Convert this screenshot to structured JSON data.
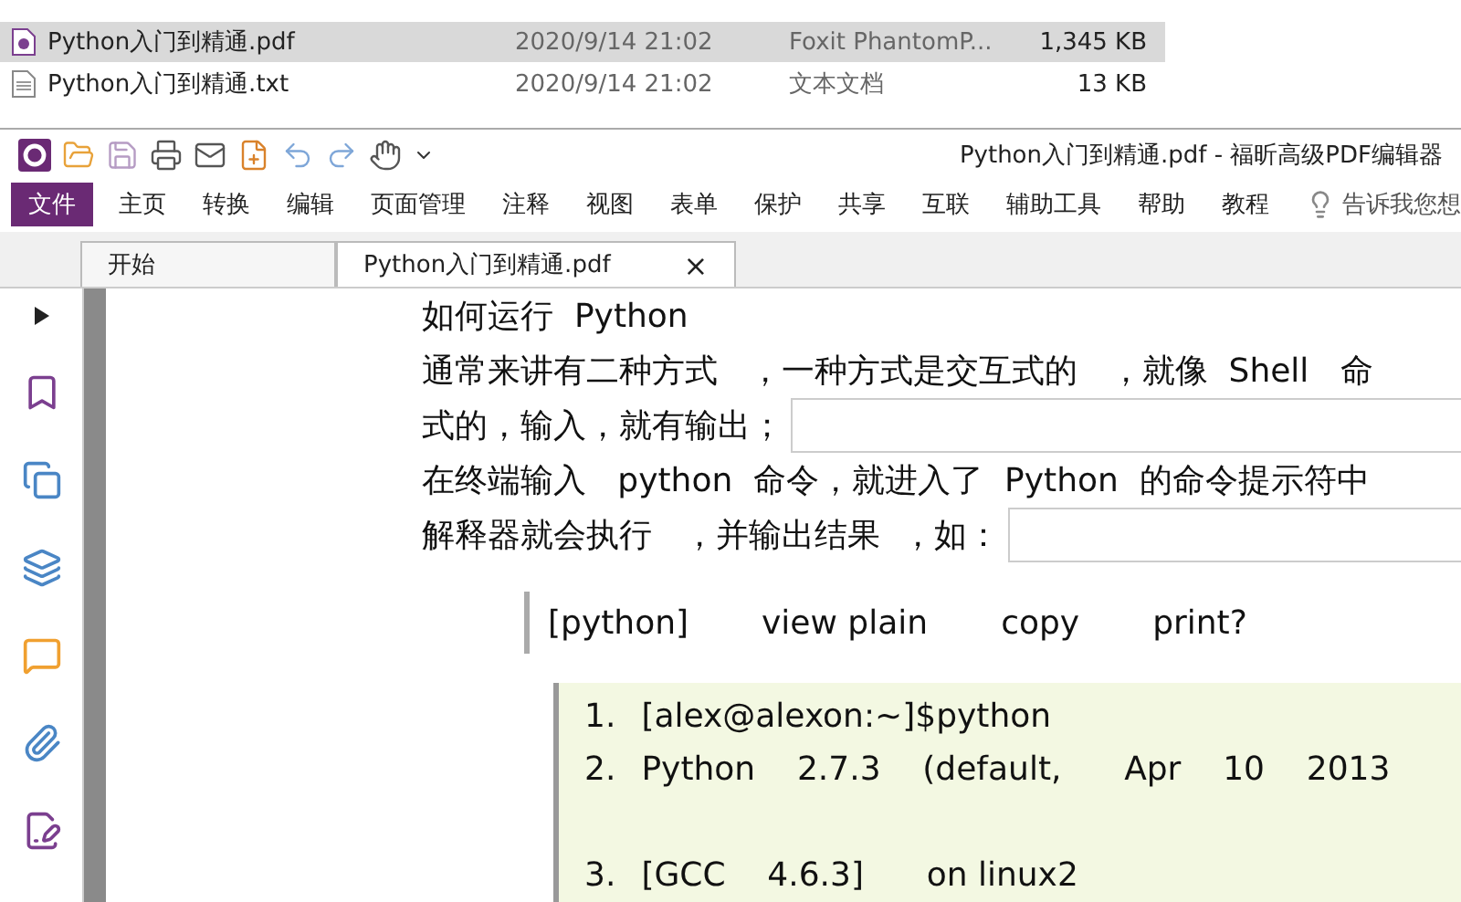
{
  "explorer": {
    "files": [
      {
        "kind": "pdf",
        "name": "Python入门到精通.pdf",
        "date": "2020/9/14 21:02",
        "type": "Foxit PhantomP...",
        "size": "1,345 KB",
        "selected": true
      },
      {
        "kind": "txt",
        "name": "Python入门到精通.txt",
        "date": "2020/9/14 21:02",
        "type": "文本文档",
        "size": "13 KB",
        "selected": false
      }
    ]
  },
  "window": {
    "title": "Python入门到精通.pdf - 福昕高级PDF编辑器"
  },
  "ribbon": {
    "file_button": "文件",
    "tabs": [
      "主页",
      "转换",
      "编辑",
      "页面管理",
      "注释",
      "视图",
      "表单",
      "保护",
      "共享",
      "互联",
      "辅助工具",
      "帮助",
      "教程"
    ],
    "tell_me": {
      "placeholder": "告诉我您想"
    }
  },
  "doc_tabs": [
    {
      "label": "开始",
      "selected": false
    },
    {
      "label": "Python入门到精通.pdf",
      "selected": true,
      "close": "×"
    }
  ],
  "document": {
    "heading": "如何运行  Python",
    "lines": [
      {
        "text": "通常来讲有二种方式   ，一种方式是交互式的   ，就像  Shell   命",
        "box": false
      },
      {
        "text": "式的，输入，就有输出；",
        "box": true
      },
      {
        "text": "在终端输入   python  命令，就进入了  Python  的命令提示符中",
        "box": false
      },
      {
        "text": "解释器就会执行   ，并输出结果  ，如：",
        "box": true
      }
    ],
    "code_toolbar": [
      "[python]",
      "view plain",
      "copy",
      "print?"
    ],
    "code_lines": [
      {
        "number": "1.",
        "text": "[alex@alexon:~]$python"
      },
      {
        "number": "2.",
        "text": "Python    2.7.3    (default,      Apr    10    2013"
      },
      {
        "number": "3.",
        "text": "[GCC    4.6.3]      on linux2"
      }
    ]
  }
}
